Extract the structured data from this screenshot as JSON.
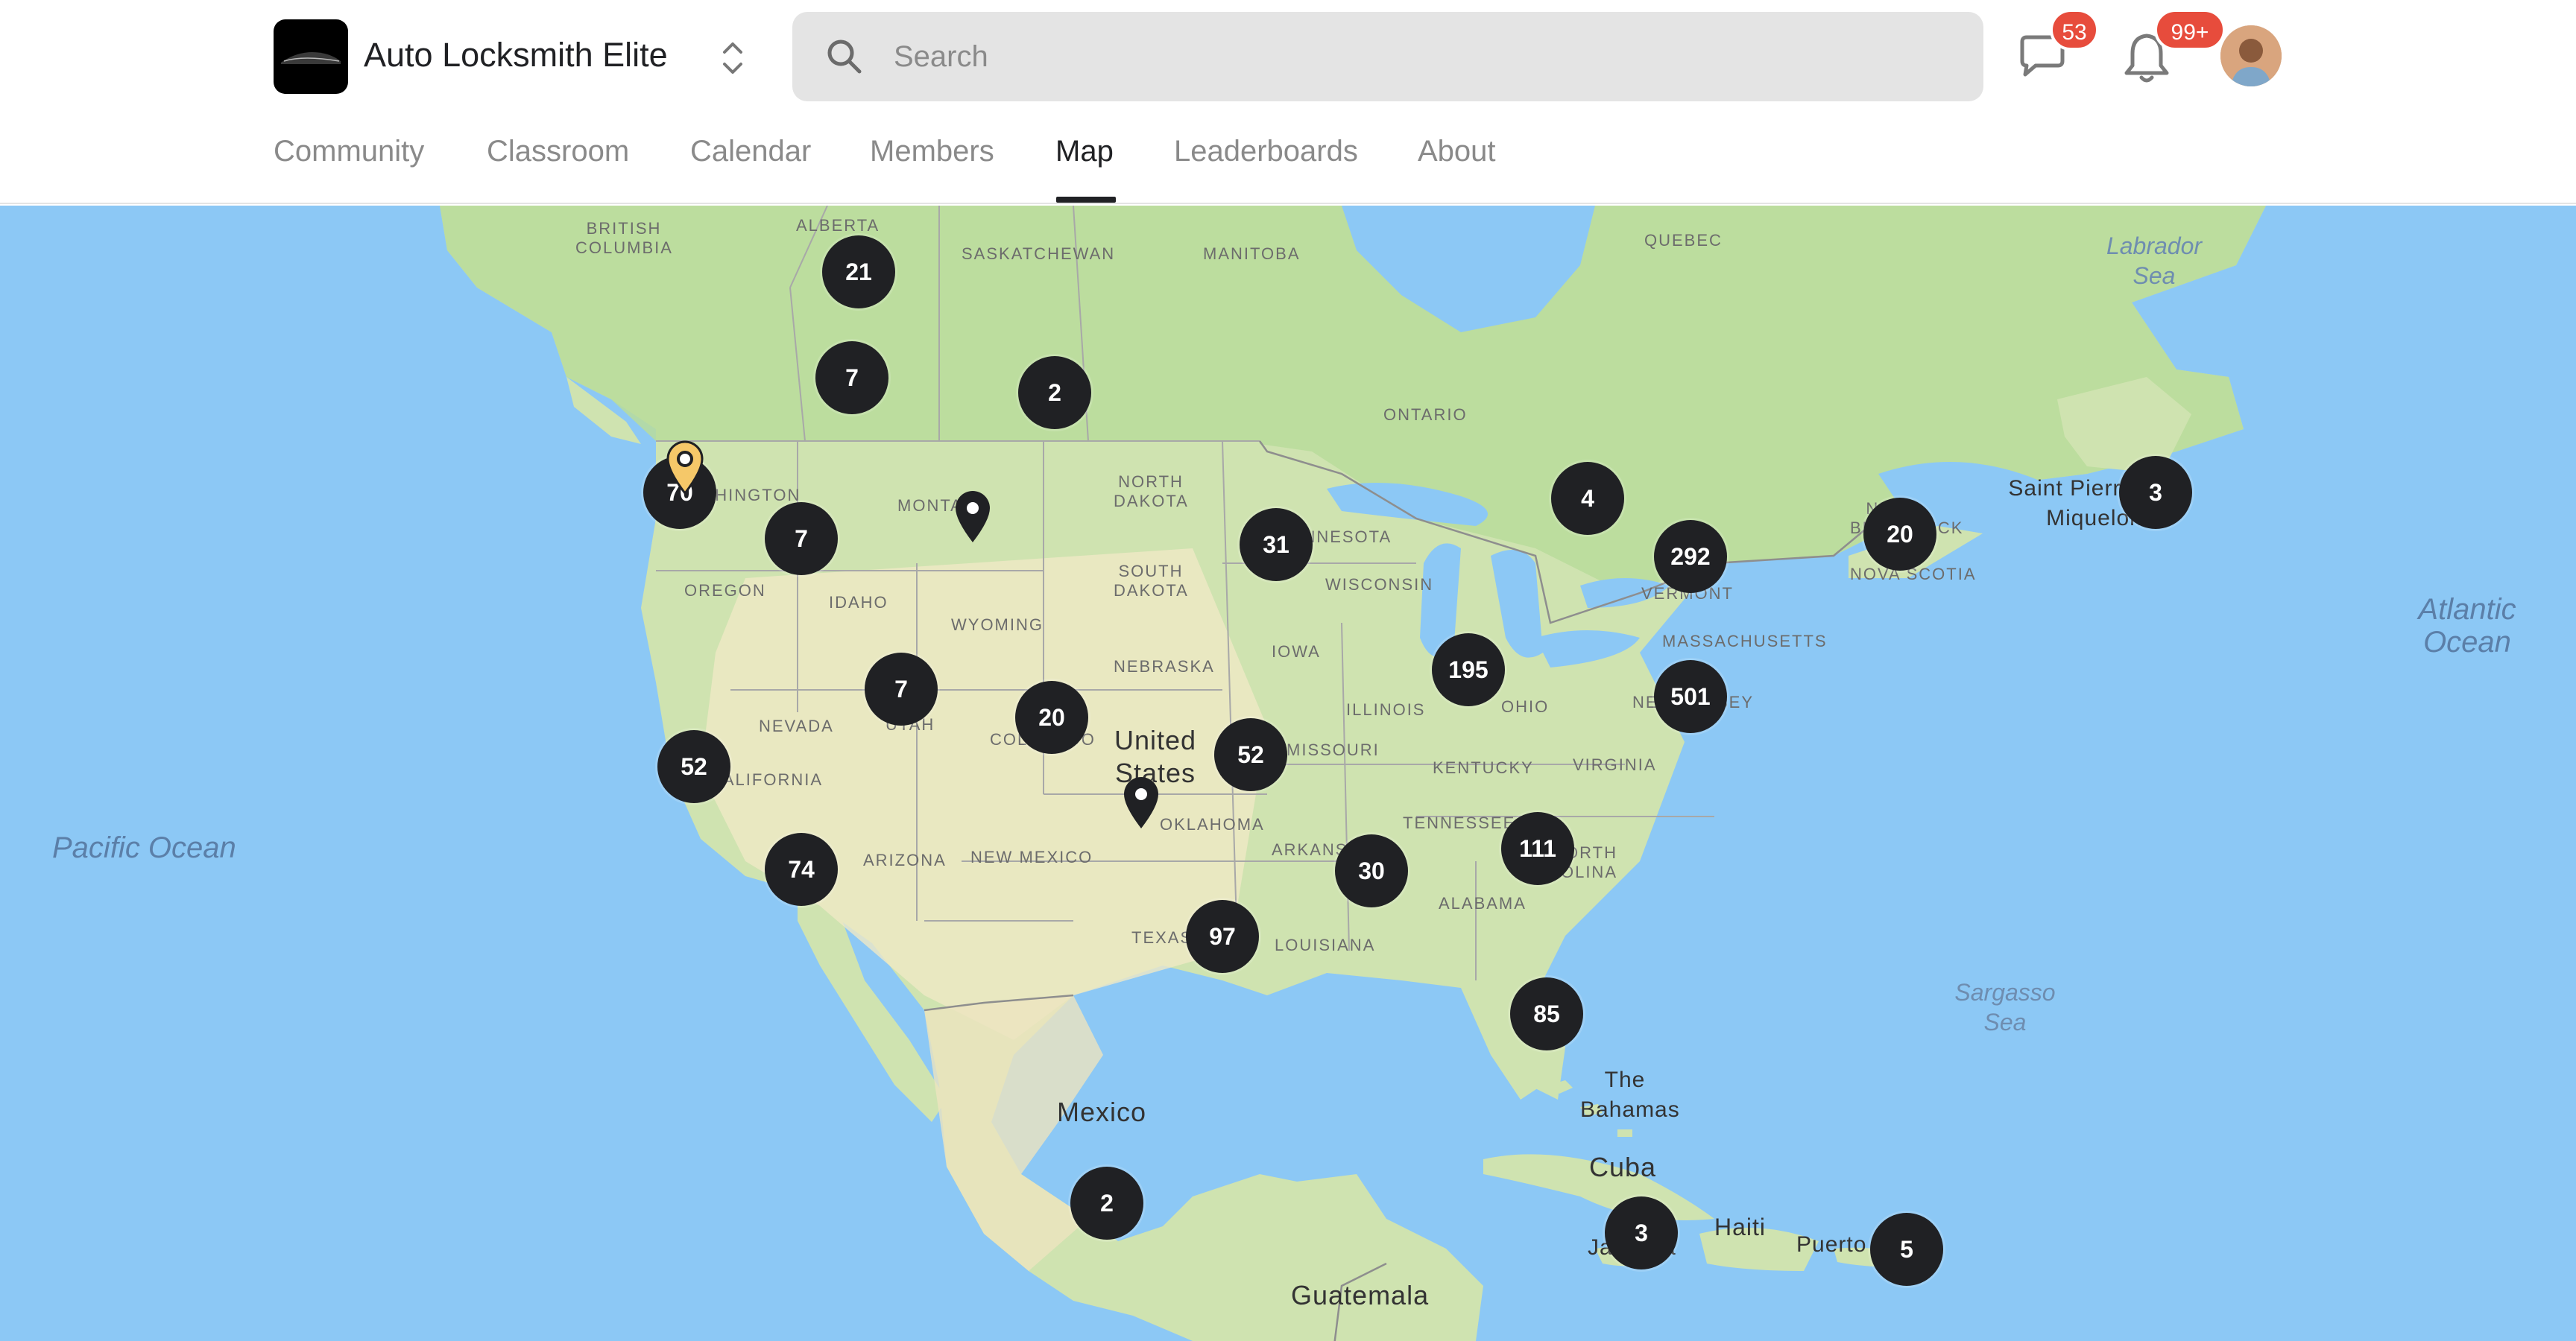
{
  "header": {
    "group_name": "Auto Locksmith Elite",
    "search_placeholder": "Search",
    "chat_badge": "53",
    "notification_badge": "99+"
  },
  "tabs": [
    {
      "label": "Community",
      "active": false
    },
    {
      "label": "Classroom",
      "active": false
    },
    {
      "label": "Calendar",
      "active": false
    },
    {
      "label": "Members",
      "active": false
    },
    {
      "label": "Map",
      "active": true
    },
    {
      "label": "Leaderboards",
      "active": false
    },
    {
      "label": "About",
      "active": false
    }
  ],
  "map": {
    "water_labels": [
      "Pacific Ocean",
      "Atlantic Ocean",
      "Labrador Sea",
      "Sargasso Sea"
    ],
    "country_labels": [
      "United States",
      "Mexico",
      "Cuba",
      "Haiti",
      "The Bahamas",
      "Guatemala",
      "Jamaica",
      "Puerto Rico",
      "Saint Pierre and Miquelon"
    ],
    "state_labels": [
      "BRITISH COLUMBIA",
      "ALBERTA",
      "SASKATCHEWAN",
      "MANITOBA",
      "ONTARIO",
      "QUEBEC",
      "WASHINGTON",
      "OREGON",
      "IDAHO",
      "MONTANA",
      "WYOMING",
      "NEVADA",
      "UTAH",
      "CALIFORNIA",
      "ARIZONA",
      "NEW MEXICO",
      "COLORADO",
      "NORTH DAKOTA",
      "SOUTH DAKOTA",
      "NEBRASKA",
      "MINNESOTA",
      "IOWA",
      "WISCONSIN",
      "ILLINOIS",
      "MISSOURI",
      "OKLAHOMA",
      "TEXAS",
      "ARKANSAS",
      "LOUISIANA",
      "TENNESSEE",
      "KENTUCKY",
      "ALABAMA",
      "OHIO",
      "VIRGINIA",
      "NORTH CAROLINA",
      "VERMONT",
      "MASSACHUSETTS",
      "NEW JERSEY",
      "NEW BRUNSWICK",
      "NOVA SCOTIA"
    ],
    "clusters": [
      "21",
      "7",
      "2",
      "70",
      "7",
      "31",
      "4",
      "292",
      "20",
      "3",
      "7",
      "20",
      "52",
      "195",
      "501",
      "52",
      "74",
      "30",
      "111",
      "97",
      "85",
      "2",
      "3",
      "5"
    ]
  }
}
